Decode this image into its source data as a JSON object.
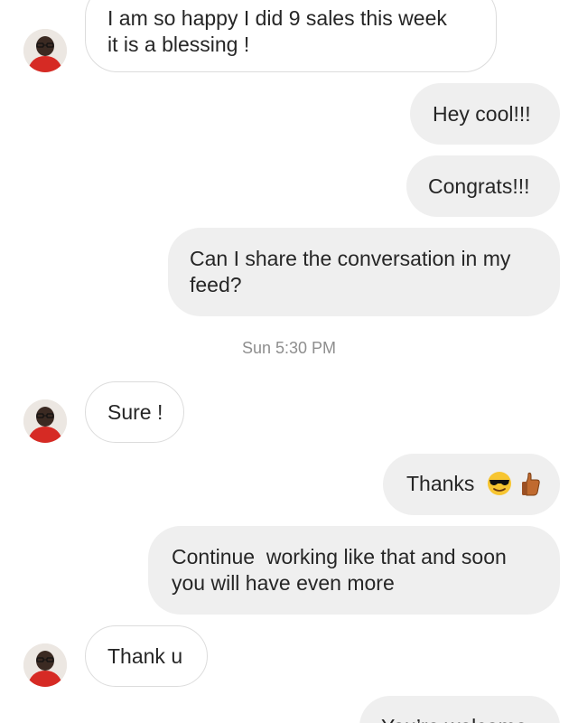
{
  "conversation": {
    "messages": [
      {
        "id": "m1",
        "direction": "incoming",
        "lines": [
          "I am so happy I did 9 sales this week",
          "it is a blessing !"
        ]
      },
      {
        "id": "m2",
        "direction": "outgoing",
        "text": "Hey cool!!!"
      },
      {
        "id": "m3",
        "direction": "outgoing",
        "text": "Congrats!!!"
      },
      {
        "id": "m4",
        "direction": "outgoing",
        "lines": [
          "Can I share the conversation in my",
          "feed?"
        ]
      },
      {
        "id": "m5",
        "direction": "incoming",
        "text": "Sure !"
      },
      {
        "id": "m6",
        "direction": "outgoing",
        "text": "Thanks",
        "emojis": [
          "sunglasses-face-emoji",
          "thumbs-up-emoji"
        ]
      },
      {
        "id": "m7",
        "direction": "outgoing",
        "lines": [
          "Continue  working like that and soon",
          "you will have even more"
        ]
      },
      {
        "id": "m8",
        "direction": "incoming",
        "text": "Thank u"
      },
      {
        "id": "m9",
        "direction": "outgoing",
        "text": "You’re welcome"
      }
    ],
    "timestamp": "Sun 5:30 PM"
  },
  "colors": {
    "outgoing_bubble": "#efefef",
    "incoming_bubble_border": "#dcdcdc",
    "timestamp_text": "#8e8e8e",
    "message_text": "#262626"
  },
  "icons": {
    "avatar": "profile-avatar-icon"
  }
}
